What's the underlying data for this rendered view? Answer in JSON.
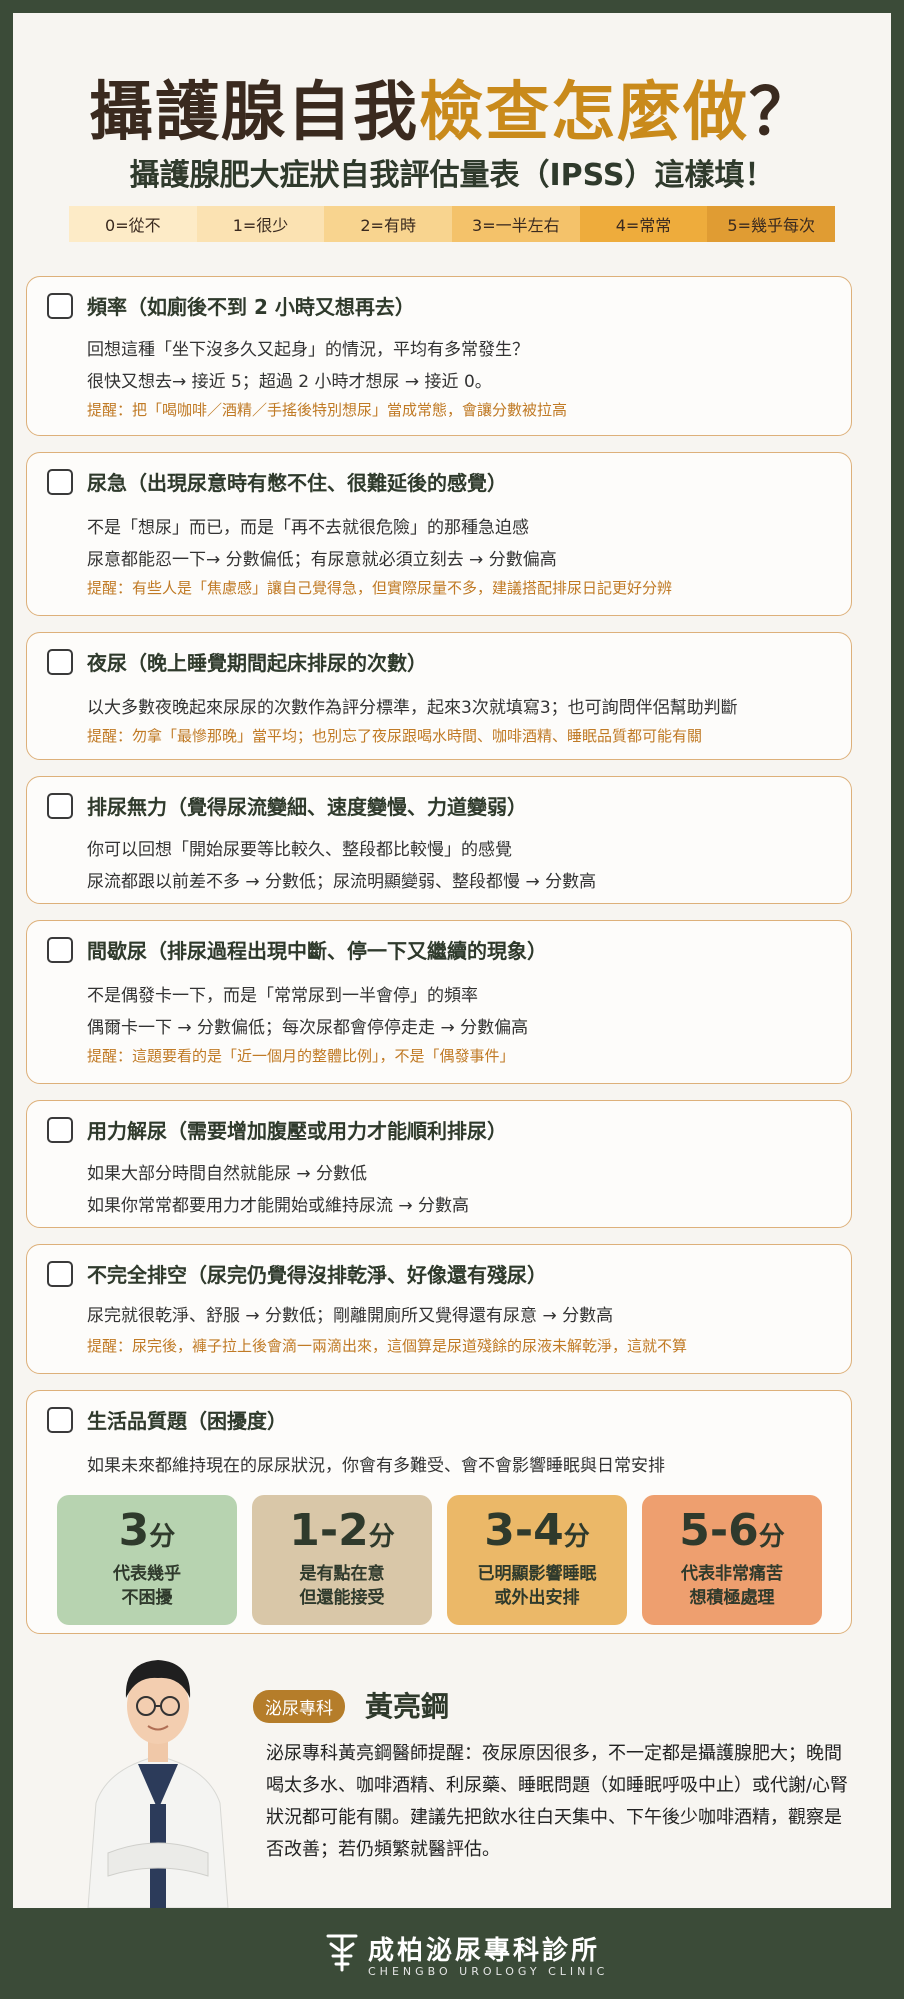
{
  "title": {
    "part1": "攝護腺自我",
    "part2": "檢查怎麼做",
    "part3": "？"
  },
  "subtitle": "攝護腺肥大症狀自我評估量表（IPSS）這樣填！",
  "scale": [
    {
      "label": "0=從不",
      "color": "#fdebc7"
    },
    {
      "label": "1=很少",
      "color": "#fbe2b2"
    },
    {
      "label": "2=有時",
      "color": "#f8d48f"
    },
    {
      "label": "3=一半左右",
      "color": "#f4c26a"
    },
    {
      "label": "4=常常",
      "color": "#eeac3c"
    },
    {
      "label": "5=幾乎每次",
      "color": "#e09c33"
    }
  ],
  "cards": [
    {
      "title": "頻率（如廁後不到 2 小時又想再去）",
      "lines": [
        "回想這種「坐下沒多久又起身」的情況，平均有多常發生？",
        "很快又想去→ 接近 5；超過 2 小時才想尿 → 接近 0。"
      ],
      "tip": "提醒：把「喝咖啡／酒精／手搖後特別想尿」當成常態，會讓分數被拉高"
    },
    {
      "title": "尿急（出現尿意時有憋不住、很難延後的感覺）",
      "lines": [
        "不是「想尿」而已，而是「再不去就很危險」的那種急迫感",
        "尿意都能忍一下→ 分數偏低；有尿意就必須立刻去 → 分數偏高"
      ],
      "tip": "提醒：有些人是「焦慮感」讓自己覺得急，但實際尿量不多，建議搭配排尿日記更好分辨"
    },
    {
      "title": "夜尿（晚上睡覺期間起床排尿的次數）",
      "lines": [
        "以大多數夜晚起來尿尿的次數作為評分標準，起來3次就填寫3；也可詢問伴侶幫助判斷"
      ],
      "tip": "提醒：勿拿「最慘那晚」當平均；也別忘了夜尿跟喝水時間、咖啡酒精、睡眠品質都可能有關"
    },
    {
      "title": "排尿無力（覺得尿流變細、速度變慢、力道變弱）",
      "lines": [
        "你可以回想「開始尿要等比較久、整段都比較慢」的感覺",
        "尿流都跟以前差不多 → 分數低；尿流明顯變弱、整段都慢 → 分數高"
      ],
      "tip": ""
    },
    {
      "title": "間歇尿（排尿過程出現中斷、停一下又繼續的現象）",
      "lines": [
        "不是偶發卡一下，而是「常常尿到一半會停」的頻率",
        "偶爾卡一下 → 分數偏低；每次尿都會停停走走 → 分數偏高"
      ],
      "tip": "提醒：這題要看的是「近一個月的整體比例」，不是「偶發事件」"
    },
    {
      "title": "用力解尿（需要增加腹壓或用力才能順利排尿）",
      "lines": [
        "如果大部分時間自然就能尿 → 分數低",
        "如果你常常都要用力才能開始或維持尿流 → 分數高"
      ],
      "tip": ""
    },
    {
      "title": "不完全排空（尿完仍覺得沒排乾淨、好像還有殘尿）",
      "lines": [
        "尿完就很乾淨、舒服 → 分數低；剛離開廁所又覺得還有尿意 → 分數高"
      ],
      "tip": "提醒：尿完後，褲子拉上後會滴一兩滴出來，這個算是尿道殘餘的尿液未解乾淨，這就不算"
    }
  ],
  "quality": {
    "title": "生活品質題（困擾度）",
    "line": "如果未來都維持現在的尿尿狀況，你會有多難受、會不會影響睡眠與日常安排",
    "unit": "分",
    "boxes": [
      {
        "score": "3",
        "label": "代表幾乎\n不困擾",
        "color": "#b7d3b0"
      },
      {
        "score": "1-2",
        "label": "是有點在意\n但還能接受",
        "color": "#d9c7a8"
      },
      {
        "score": "3-4",
        "label": "已明顯影響睡眠\n或外出安排",
        "color": "#ebb868"
      },
      {
        "score": "5-6",
        "label": "代表非常痛苦\n想積極處理",
        "color": "#ee9f6f"
      }
    ]
  },
  "doctor": {
    "specialty": "泌尿專科",
    "name": "黃亮鋼",
    "note": "泌尿專科黃亮鋼醫師提醒：夜尿原因很多，不一定都是攝護腺肥大；晚間喝太多水、咖啡酒精、利尿藥、睡眠問題（如睡眠呼吸中止）或代謝/心腎狀況都可能有關。建議先把飲水往白天集中、下午後少咖啡酒精，觀察是否改善；若仍頻繁就醫評估。"
  },
  "footer": {
    "name": "成柏泌尿專科診所",
    "en": "CHENGBO UROLOGY CLINIC"
  }
}
